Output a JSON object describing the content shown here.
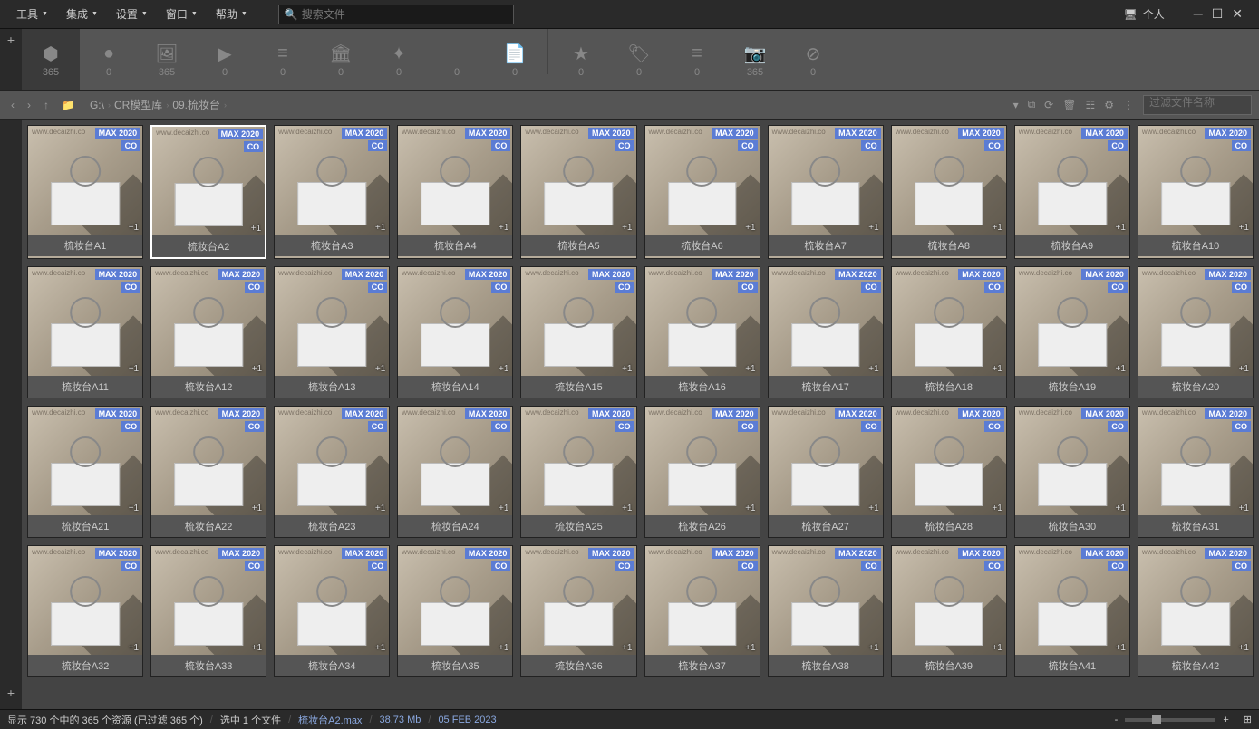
{
  "menu": {
    "items": [
      "工具",
      "集成",
      "设置",
      "窗口",
      "帮助"
    ],
    "search_placeholder": "搜索文件",
    "personal": "个人"
  },
  "toolbar": [
    {
      "icon": "cube",
      "count": "365",
      "active": true
    },
    {
      "icon": "sphere",
      "count": "0"
    },
    {
      "icon": "image",
      "count": "365"
    },
    {
      "icon": "video",
      "count": "0"
    },
    {
      "icon": "audio",
      "count": "0"
    },
    {
      "icon": "building",
      "count": "0"
    },
    {
      "icon": "compass",
      "count": "0"
    },
    {
      "icon": "code",
      "count": "0"
    },
    {
      "icon": "file",
      "count": "0"
    },
    {
      "sep": true
    },
    {
      "icon": "star",
      "count": "0"
    },
    {
      "icon": "tag",
      "count": "0"
    },
    {
      "icon": "lines",
      "count": "0"
    },
    {
      "icon": "camera",
      "count": "365"
    },
    {
      "icon": "forbidden",
      "count": "0"
    }
  ],
  "breadcrumb": {
    "parts": [
      "G:\\",
      "CR模型库",
      "09.梳妆台"
    ],
    "filter_placeholder": "过滤文件名称"
  },
  "grid": {
    "badge_max": "MAX 2020",
    "badge_co": "CO",
    "plus": "+1",
    "items": [
      {
        "label": "梳妆台A1"
      },
      {
        "label": "梳妆台A2",
        "selected": true
      },
      {
        "label": "梳妆台A3"
      },
      {
        "label": "梳妆台A4"
      },
      {
        "label": "梳妆台A5"
      },
      {
        "label": "梳妆台A6"
      },
      {
        "label": "梳妆台A7"
      },
      {
        "label": "梳妆台A8"
      },
      {
        "label": "梳妆台A9"
      },
      {
        "label": "梳妆台A10"
      },
      {
        "label": "梳妆台A11"
      },
      {
        "label": "梳妆台A12"
      },
      {
        "label": "梳妆台A13"
      },
      {
        "label": "梳妆台A14"
      },
      {
        "label": "梳妆台A15"
      },
      {
        "label": "梳妆台A16"
      },
      {
        "label": "梳妆台A17"
      },
      {
        "label": "梳妆台A18"
      },
      {
        "label": "梳妆台A19"
      },
      {
        "label": "梳妆台A20"
      },
      {
        "label": "梳妆台A21"
      },
      {
        "label": "梳妆台A22"
      },
      {
        "label": "梳妆台A23"
      },
      {
        "label": "梳妆台A24"
      },
      {
        "label": "梳妆台A25"
      },
      {
        "label": "梳妆台A26"
      },
      {
        "label": "梳妆台A27"
      },
      {
        "label": "梳妆台A28"
      },
      {
        "label": "梳妆台A30"
      },
      {
        "label": "梳妆台A31"
      },
      {
        "label": "梳妆台A32"
      },
      {
        "label": "梳妆台A33"
      },
      {
        "label": "梳妆台A34"
      },
      {
        "label": "梳妆台A35"
      },
      {
        "label": "梳妆台A36"
      },
      {
        "label": "梳妆台A37"
      },
      {
        "label": "梳妆台A38"
      },
      {
        "label": "梳妆台A39"
      },
      {
        "label": "梳妆台A41"
      },
      {
        "label": "梳妆台A42"
      }
    ]
  },
  "status": {
    "count": "显示 730 个中的 365 个资源 (已过滤 365 个)",
    "selection": "选中 1 个文件",
    "filename": "梳妆台A2.max",
    "size": "38.73 Mb",
    "date": "05 FEB 2023"
  }
}
